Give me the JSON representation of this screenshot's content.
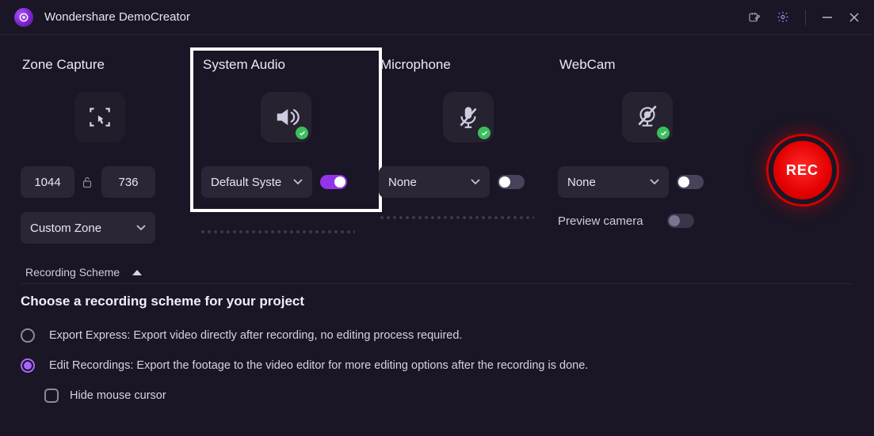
{
  "app": {
    "title": "Wondershare DemoCreator"
  },
  "zone": {
    "label": "Zone Capture",
    "width": "1044",
    "height": "736",
    "mode": "Custom Zone"
  },
  "audio": {
    "label": "System Audio",
    "device": "Default Syste",
    "enabled": true
  },
  "mic": {
    "label": "Microphone",
    "device": "None",
    "enabled": false
  },
  "cam": {
    "label": "WebCam",
    "device": "None",
    "enabled": false,
    "preview_label": "Preview camera",
    "preview_enabled": false
  },
  "rec": {
    "label": "REC"
  },
  "scheme": {
    "toggle_label": "Recording Scheme",
    "heading": "Choose a recording scheme for your project",
    "options": [
      {
        "text": "Export Express: Export video directly after recording, no editing process required.",
        "selected": false
      },
      {
        "text": "Edit Recordings: Export the footage to the video editor for more editing options after the recording is done.",
        "selected": true
      }
    ],
    "hide_cursor_label": "Hide mouse cursor"
  }
}
